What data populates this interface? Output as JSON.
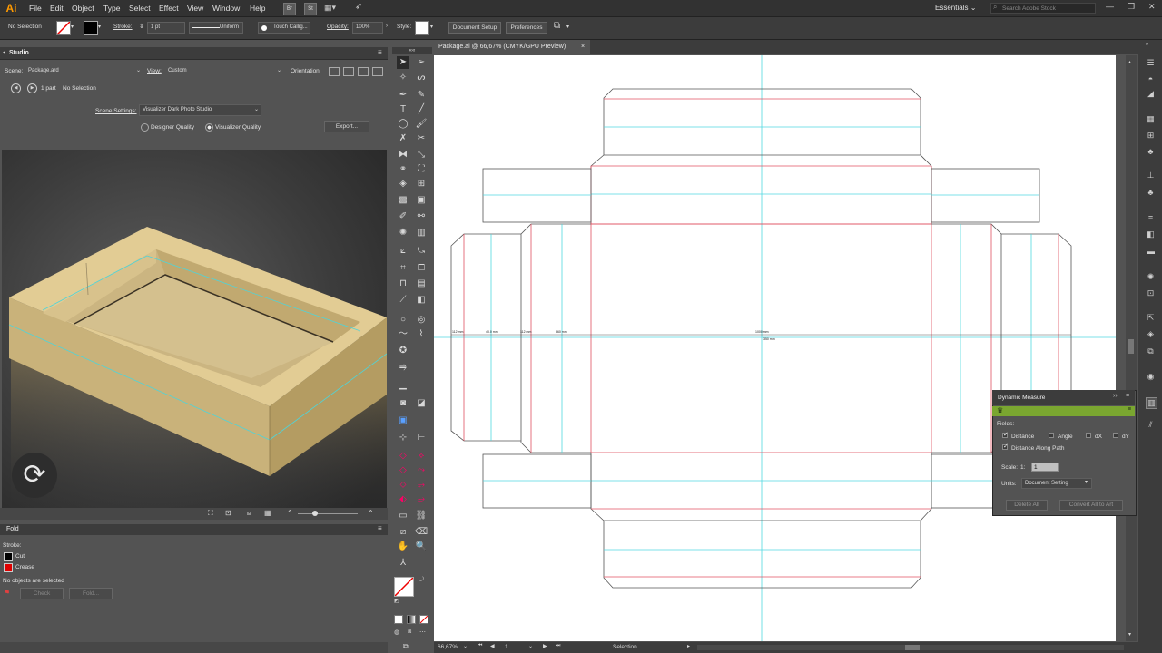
{
  "app": {
    "logo": "Ai"
  },
  "menu": [
    "File",
    "Edit",
    "Object",
    "Type",
    "Select",
    "Effect",
    "View",
    "Window",
    "Help"
  ],
  "bridge_icons": [
    "Br",
    "St"
  ],
  "workspace": "Essentials",
  "search_placeholder": "Search Adobe Stock",
  "control": {
    "selection": "No Selection",
    "stroke_label": "Stroke:",
    "stroke_value": "1 pt",
    "profile": "Uniform",
    "brush": "Touch Callig...",
    "opacity_label": "Opacity:",
    "opacity_value": "100%",
    "style_label": "Style:",
    "doc_setup": "Document Setup",
    "preferences": "Preferences"
  },
  "studio": {
    "title": "Studio",
    "scene_label": "Scene:",
    "scene_value": "Package.ard",
    "view_label": "View:",
    "view_value": "Custom",
    "orientation_label": "Orientation:",
    "parts": "1 part",
    "selection": "No Selection",
    "scene_settings_label": "Scene Settings:",
    "scene_settings_value": "Visualizer Dark Photo Studio",
    "quality_designer": "Designer Quality",
    "quality_visualizer": "Visualizer Quality",
    "export": "Export..."
  },
  "fold": {
    "title": "Fold",
    "stroke_label": "Stroke:",
    "cut": "Cut",
    "crease": "Crease",
    "no_objects": "No objects are selected",
    "check": "Check",
    "fold_btn": "Fold...",
    "colors": {
      "cut": "#000000",
      "crease": "#e00000"
    }
  },
  "document": {
    "tab_title": "Package.ai @ 66,67% (CMYK/GPU Preview)",
    "zoom": "66,67%",
    "artboard": "1",
    "status": "Selection",
    "dimensions": [
      "112 mm",
      "40.0 mm",
      "112 mm",
      "360 mm",
      "1000 mm",
      "350 mm"
    ],
    "colors": {
      "cut": "#555555",
      "crease": "#e05060",
      "guide": "#50d8e0"
    }
  },
  "dynamic_measure": {
    "title": "Dynamic Measure",
    "fields_label": "Fields:",
    "distance": "Distance",
    "angle": "Angle",
    "dx": "dX",
    "dy": "dY",
    "distance_along_path": "Distance Along Path",
    "scale_label": "Scale:",
    "scale_prefix": "1:",
    "scale_value": "1",
    "units_label": "Units:",
    "units_value": "Document Setting",
    "delete_all": "Delete All",
    "convert_all": "Convert All to Art",
    "checked": {
      "distance": true,
      "angle": false,
      "dx": false,
      "dy": false,
      "distance_along_path": true
    }
  }
}
